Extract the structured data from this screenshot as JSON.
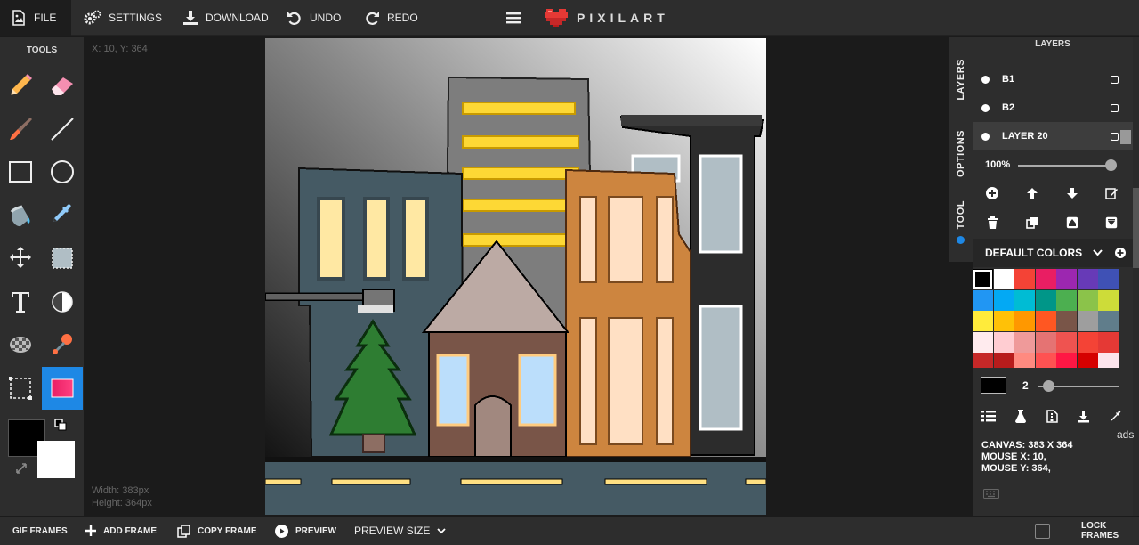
{
  "topbar": {
    "file_label": "FILE",
    "settings_label": "SETTINGS",
    "download_label": "DOWNLOAD",
    "undo_label": "UNDO",
    "redo_label": "REDO",
    "logo_text": "PIXILART"
  },
  "tools": {
    "title": "TOOLS",
    "items": [
      "pencil-icon",
      "eraser-icon",
      "brush-icon",
      "line-icon",
      "rectangle-icon",
      "circle-icon",
      "bucket-icon",
      "eyedropper-icon",
      "move-icon",
      "select-icon",
      "text-icon",
      "lighten-icon",
      "dither-icon",
      "stamp-icon",
      "crop-icon",
      "gradient-icon"
    ],
    "active": "gradient-icon",
    "primary_color": "#000000",
    "secondary_color": "#ffffff"
  },
  "workspace": {
    "mouse_coords": "X: 10, Y: 364",
    "width_text": "Width: 383px",
    "height_text": "Height: 364px"
  },
  "side_tabs": [
    "LAYERS",
    "OPTIONS",
    "TOOL"
  ],
  "layers": {
    "title": "LAYERS",
    "items": [
      {
        "name": "B1",
        "selected": false
      },
      {
        "name": "B2",
        "selected": false
      },
      {
        "name": "LAYER 20",
        "selected": true
      }
    ],
    "opacity": "100%",
    "opacity_value": 1.0
  },
  "palette": {
    "title": "DEFAULT COLORS",
    "colors": [
      "#000000",
      "#ffffff",
      "#f44336",
      "#e91e63",
      "#9c27b0",
      "#673ab7",
      "#3f51b5",
      "#2196f3",
      "#03a9f4",
      "#00bcd4",
      "#009688",
      "#4caf50",
      "#8bc34a",
      "#cddc39",
      "#ffeb3b",
      "#ffc107",
      "#ff9800",
      "#ff5722",
      "#795548",
      "#9e9e9e",
      "#607d8b",
      "#ffebee",
      "#ffcdd2",
      "#ef9a9a",
      "#e57373",
      "#ef5350",
      "#f44336",
      "#e53935",
      "#c62828",
      "#b71c1c",
      "#ff8a80",
      "#ff5252",
      "#ff1744",
      "#d50000",
      "#fce4ec"
    ],
    "selected_index": 0
  },
  "brush": {
    "color": "#000000",
    "size": "2"
  },
  "canvas_info": {
    "canvas": "CANVAS: 383 X 364",
    "mouse_x": "MOUSE X: 10,",
    "mouse_y": "MOUSE Y: 364,"
  },
  "ads_label": "ads",
  "bottombar": {
    "gif_frames": "GIF FRAMES",
    "add_frame": "ADD FRAME",
    "copy_frame": "COPY FRAME",
    "preview": "PREVIEW",
    "preview_size": "PREVIEW SIZE",
    "lock_frames": "LOCK FRAMES"
  }
}
